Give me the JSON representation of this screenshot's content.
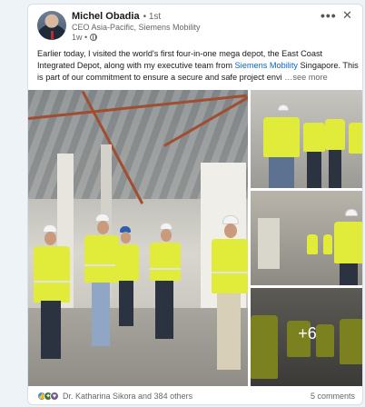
{
  "post": {
    "author": {
      "name": "Michel Obadia",
      "degree": "• 1st",
      "role": "CEO Asia-Pacific, Siemens Mobility",
      "time": "1w •"
    },
    "menu": {
      "more_label": "•••",
      "close_label": "✕"
    },
    "text": {
      "part1": "Earlier today, I visited the world's first four-in-one mega depot, the East Coast Integrated Depot, along with my executive team from ",
      "link": "Siemens Mobility",
      "part2": " Singapore. This is part of our commitment to ensure a secure and safe project envi",
      "see_more": "  …see more"
    },
    "gallery": {
      "extra_count": "+6"
    },
    "social": {
      "reactions_text": "Dr. Katharina Sikora and 384 others",
      "comments_text": "5 comments",
      "reaction_icons": [
        "like-icon",
        "celebrate-icon",
        "support-icon"
      ]
    }
  },
  "colors": {
    "link": "#0a66c2",
    "vest": "#e1ec3a",
    "like": "#378fe9"
  }
}
